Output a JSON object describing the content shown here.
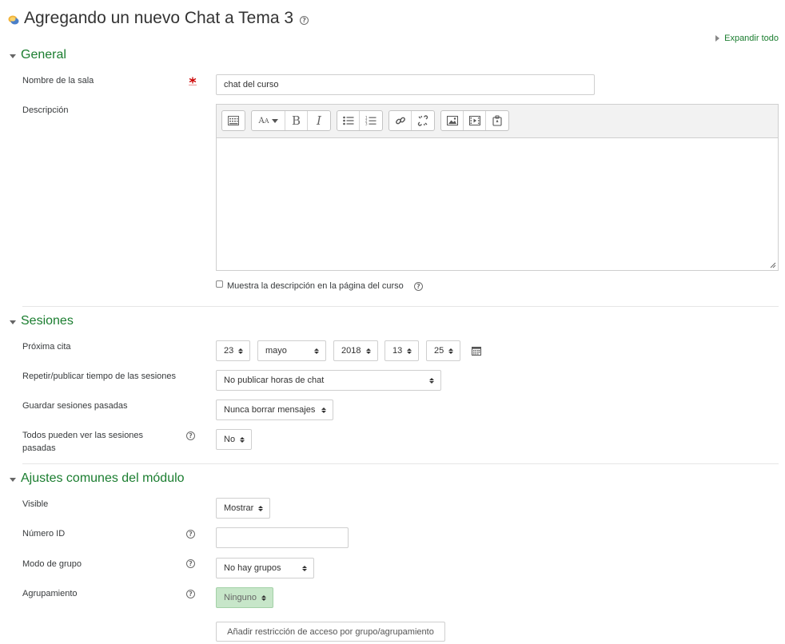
{
  "header": {
    "title": "Agregando un nuevo Chat a Tema 3",
    "module_icon": "chat-module-icon",
    "help_icon": "question-circle-icon",
    "expand_all": "Expandir todo"
  },
  "sections": {
    "general": {
      "title": "General",
      "room_name_label": "Nombre de la sala",
      "room_name_value": "chat del curso",
      "description_label": "Descripción",
      "show_description_label": "Muestra la descripción en la página del curso",
      "toolbar_icons": [
        "toolbar-toggle-icon",
        "font-style-icon",
        "bold-icon",
        "italic-icon",
        "unordered-list-icon",
        "ordered-list-icon",
        "link-icon",
        "unlink-icon",
        "image-icon",
        "media-icon",
        "manage-files-icon"
      ]
    },
    "sessions": {
      "title": "Sesiones",
      "next_chat_label": "Próxima cita",
      "day": "23",
      "month": "mayo",
      "year": "2018",
      "hour": "13",
      "minute": "25",
      "calendar_icon": "calendar-icon",
      "repeat_label": "Repetir/publicar tiempo de las sesiones",
      "repeat_value": "No publicar horas de chat",
      "keep_label": "Guardar sesiones pasadas",
      "keep_value": "Nunca borrar mensajes",
      "everyone_view_label_line1": "Todos pueden ver las sesiones",
      "everyone_view_label_line2": "pasadas",
      "everyone_view_value": "No"
    },
    "common": {
      "title": "Ajustes comunes del módulo",
      "visible_label": "Visible",
      "visible_value": "Mostrar",
      "id_label": "Número ID",
      "id_value": "",
      "group_mode_label": "Modo de grupo",
      "group_mode_value": "No hay grupos",
      "grouping_label": "Agrupamiento",
      "grouping_value": "Ninguno",
      "restriction_button": "Añadir restricción de acceso por grupo/agrupamiento"
    }
  },
  "colors": {
    "accent_green": "#1a7d2f",
    "required_red": "#cc0000",
    "disabled_green_bg": "#c7e6c9"
  }
}
